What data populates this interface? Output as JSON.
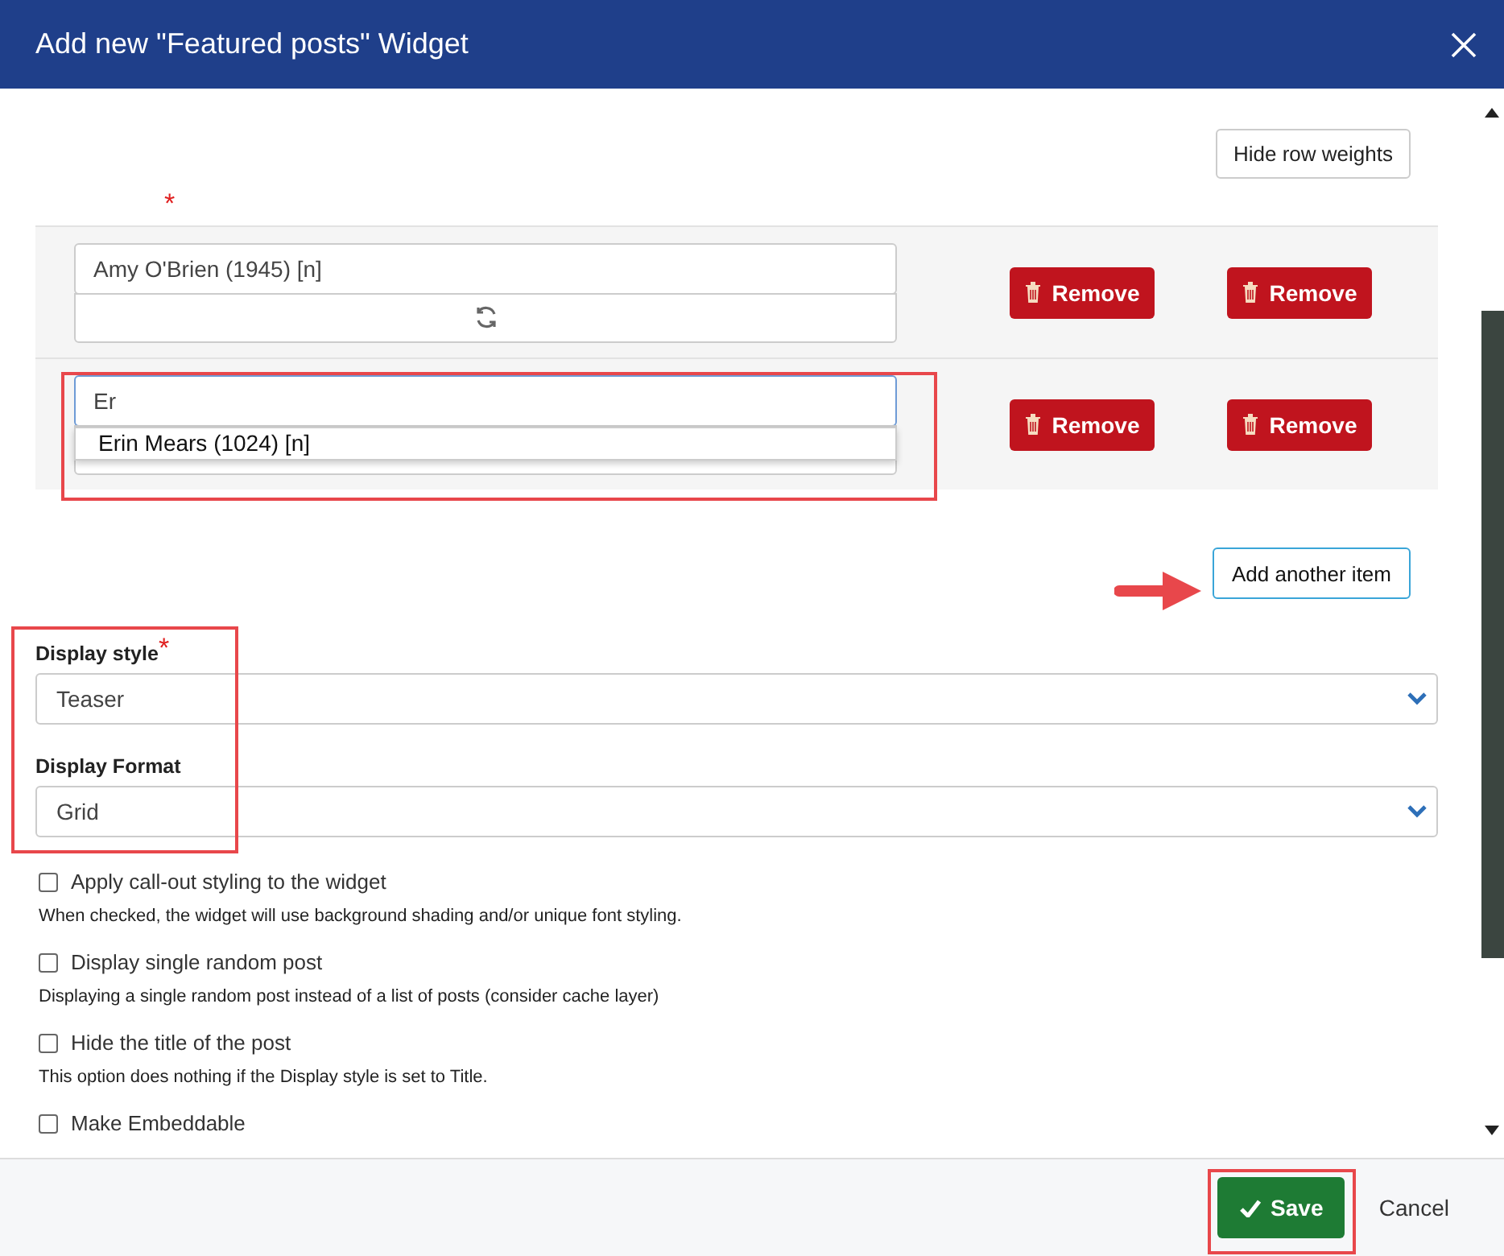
{
  "dialog": {
    "title": "Add new \"Featured posts\" Widget"
  },
  "hide_row_weights": "Hide row weights",
  "items_required_mark": "*",
  "items": [
    {
      "value": "Amy O'Brien (1945) [n]",
      "focused": false,
      "removes": [
        "Remove",
        "Remove"
      ]
    },
    {
      "value": "Er",
      "focused": true,
      "suggestion": "Erin Mears (1024) [n]",
      "removes": [
        "Remove",
        "Remove"
      ]
    }
  ],
  "add_button": "Add another item",
  "selects": [
    {
      "label": "Display style",
      "required_mark": "*",
      "value": "Teaser"
    },
    {
      "label": "Display Format",
      "value": "Grid"
    }
  ],
  "checkboxes": [
    {
      "label": "Apply call-out styling to the widget",
      "checked": false,
      "help": "When checked, the widget will use background shading and/or unique font styling."
    },
    {
      "label": "Display single random post",
      "checked": false,
      "help": "Displaying a single random post instead of a list of posts (consider cache layer)"
    },
    {
      "label": "Hide the title of the post",
      "checked": false,
      "help": "This option does nothing if the Display style is set to Title."
    },
    {
      "label": "Make Embeddable",
      "checked": false
    }
  ],
  "footer": {
    "save": "Save",
    "cancel": "Cancel"
  }
}
